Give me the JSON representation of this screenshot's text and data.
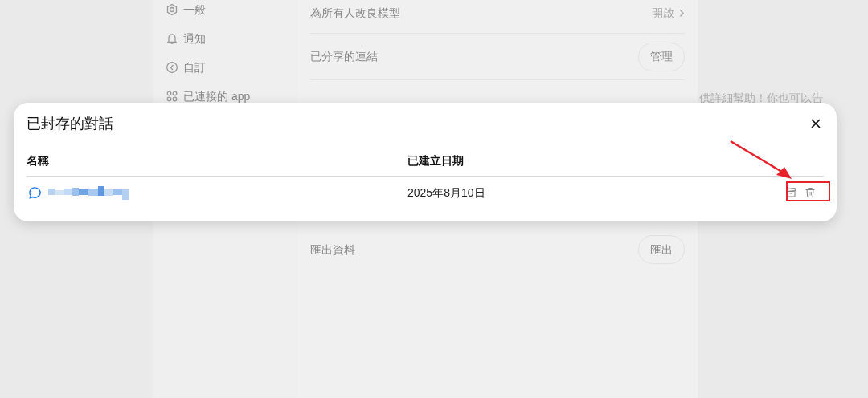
{
  "sidebar": {
    "items": [
      {
        "label": "一般"
      },
      {
        "label": "通知"
      },
      {
        "label": "自訂"
      },
      {
        "label": "已連接的 app"
      }
    ]
  },
  "settings_rows": [
    {
      "label": "為所有人改良模型",
      "value": "開啟",
      "kind": "link"
    },
    {
      "label": "已分享的連結",
      "button": "管理",
      "kind": "button"
    },
    {
      "kind": "hidden"
    },
    {
      "label": "匯出資料",
      "button": "匯出",
      "kind": "button"
    }
  ],
  "side_text": "供詳細幫助！你也可以告",
  "dialog": {
    "title": "已封存的對話",
    "columns": [
      "名稱",
      "已建立日期"
    ],
    "rows": [
      {
        "date": "2025年8月10日"
      }
    ]
  }
}
